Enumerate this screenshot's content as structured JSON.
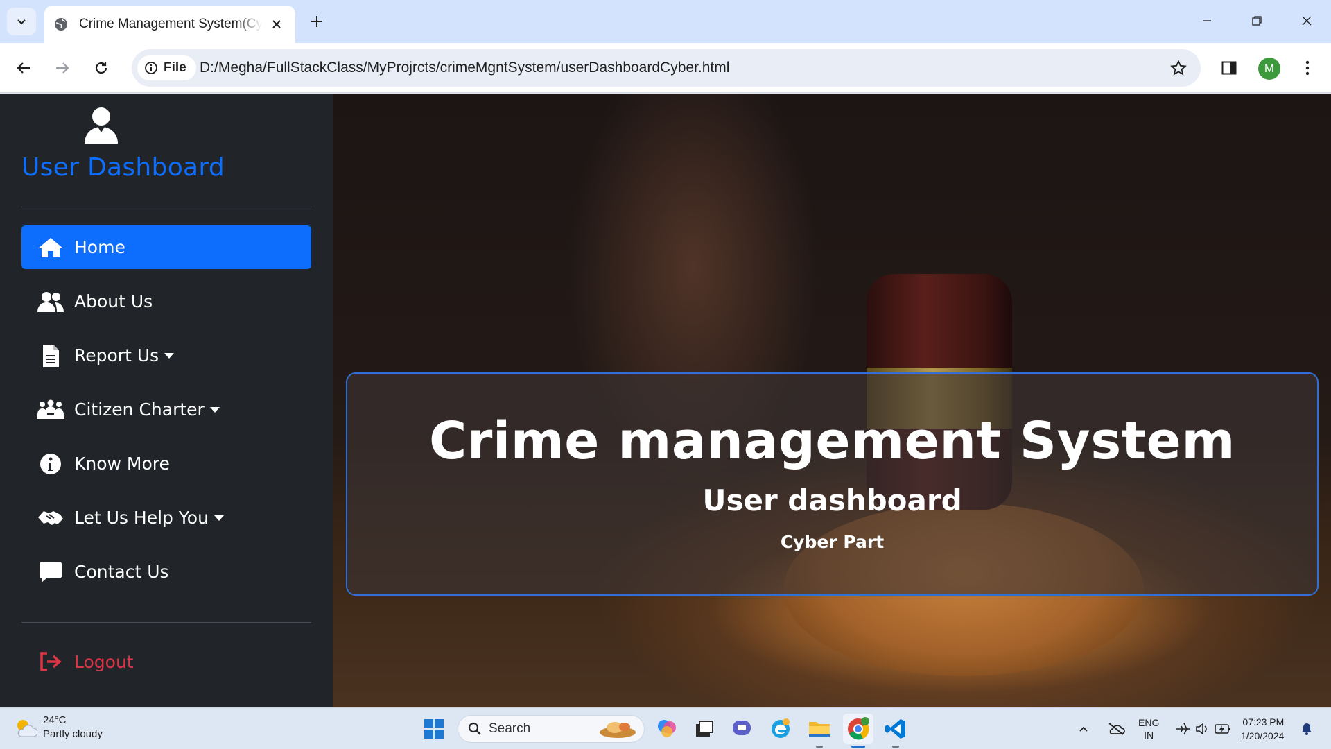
{
  "browser": {
    "tab_title": "Crime Management System(Cyber)",
    "site_chip": "File",
    "url": "D:/Megha/FullStackClass/MyProjrcts/crimeMgntSystem/userDashboardCyber.html",
    "profile_initial": "M"
  },
  "sidebar": {
    "title": "User Dashboard",
    "items": [
      {
        "label": "Home",
        "icon": "home-icon",
        "active": true,
        "dropdown": false
      },
      {
        "label": "About Us",
        "icon": "users-icon",
        "active": false,
        "dropdown": false
      },
      {
        "label": "Report Us",
        "icon": "file-icon",
        "active": false,
        "dropdown": true
      },
      {
        "label": "Citizen Charter",
        "icon": "people-group-icon",
        "active": false,
        "dropdown": true
      },
      {
        "label": "Know More",
        "icon": "info-icon",
        "active": false,
        "dropdown": false
      },
      {
        "label": "Let Us Help You",
        "icon": "handshake-icon",
        "active": false,
        "dropdown": true
      },
      {
        "label": "Contact Us",
        "icon": "message-icon",
        "active": false,
        "dropdown": false
      }
    ],
    "logout_label": "Logout"
  },
  "hero": {
    "title": "Crime management System",
    "subtitle": "User dashboard",
    "tagline": "Cyber Part"
  },
  "taskbar": {
    "temperature": "24°C",
    "weather": "Partly cloudy",
    "search_label": "Search",
    "language": "ENG",
    "region": "IN",
    "time": "07:23 PM",
    "date": "1/20/2024"
  },
  "colors": {
    "accent": "#0d6efd",
    "sidebar_bg": "#212529",
    "logout": "#dc3545"
  }
}
